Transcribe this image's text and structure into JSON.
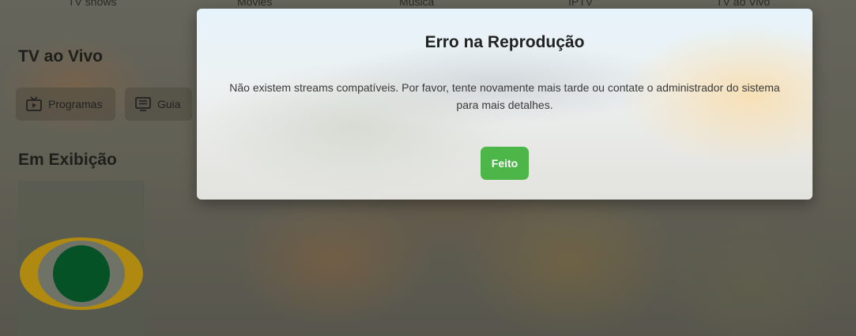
{
  "nav": {
    "items": [
      "TV shows",
      "Movies",
      "Música",
      "IPTV",
      "TV ao Vivo"
    ]
  },
  "live_tv": {
    "title": "TV ao Vivo",
    "buttons": [
      {
        "label": "Programas",
        "icon": "tv-icon"
      },
      {
        "label": "Guia",
        "icon": "guide-icon"
      }
    ]
  },
  "now_playing": {
    "title": "Em Exibição",
    "channel_logo": {
      "ring_color": "#d9a400",
      "center_color": "#005a28"
    }
  },
  "dialog": {
    "title": "Erro na Reprodução",
    "message": "Não existem streams compatíveis. Por favor, tente novamente mais tarde ou contate o administrador do sistema para mais detalhes.",
    "confirm_label": "Feito",
    "confirm_color": "#4cb748"
  }
}
